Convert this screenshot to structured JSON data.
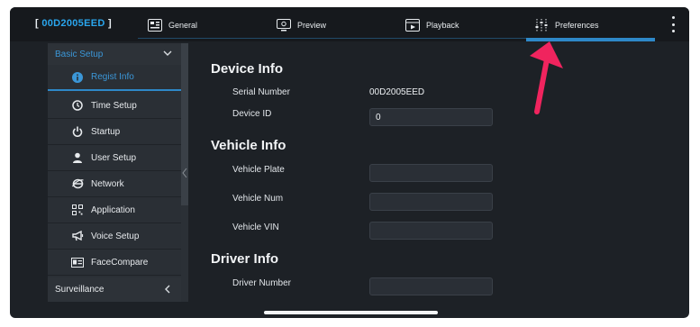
{
  "header": {
    "device_id": "00D2005EED",
    "bracket_open": "[",
    "bracket_close": "]",
    "tabs": [
      {
        "label": "General",
        "icon": "general-icon"
      },
      {
        "label": "Preview",
        "icon": "monitor-icon"
      },
      {
        "label": "Playback",
        "icon": "film-icon"
      },
      {
        "label": "Preferences",
        "icon": "sliders-icon"
      }
    ],
    "active_tab": "Preferences"
  },
  "sidebar": {
    "basic_setup": "Basic Setup",
    "items": [
      {
        "label": "Regist Info",
        "icon": "info-icon"
      },
      {
        "label": "Time Setup",
        "icon": "clock-icon"
      },
      {
        "label": "Startup",
        "icon": "power-icon"
      },
      {
        "label": "User Setup",
        "icon": "user-icon"
      },
      {
        "label": "Network",
        "icon": "globe-icon"
      },
      {
        "label": "Application",
        "icon": "grid-icon"
      },
      {
        "label": "Voice Setup",
        "icon": "megaphone-icon"
      },
      {
        "label": "FaceCompare",
        "icon": "id-card-icon"
      }
    ],
    "active_item": "Regist Info",
    "surveillance": "Surveillance"
  },
  "content": {
    "device_info": {
      "title": "Device Info",
      "serial_label": "Serial Number",
      "serial_value": "00D2005EED",
      "device_id_label": "Device ID",
      "device_id_value": "0"
    },
    "vehicle_info": {
      "title": "Vehicle Info",
      "plate_label": "Vehicle Plate",
      "plate_value": "",
      "num_label": "Vehicle Num",
      "num_value": "",
      "vin_label": "Vehicle VIN",
      "vin_value": ""
    },
    "driver_info": {
      "title": "Driver Info",
      "number_label": "Driver Number",
      "number_value": ""
    }
  },
  "colors": {
    "accent": "#2e88c8",
    "annotation_arrow": "#f0245e",
    "background": "#1d2126"
  }
}
